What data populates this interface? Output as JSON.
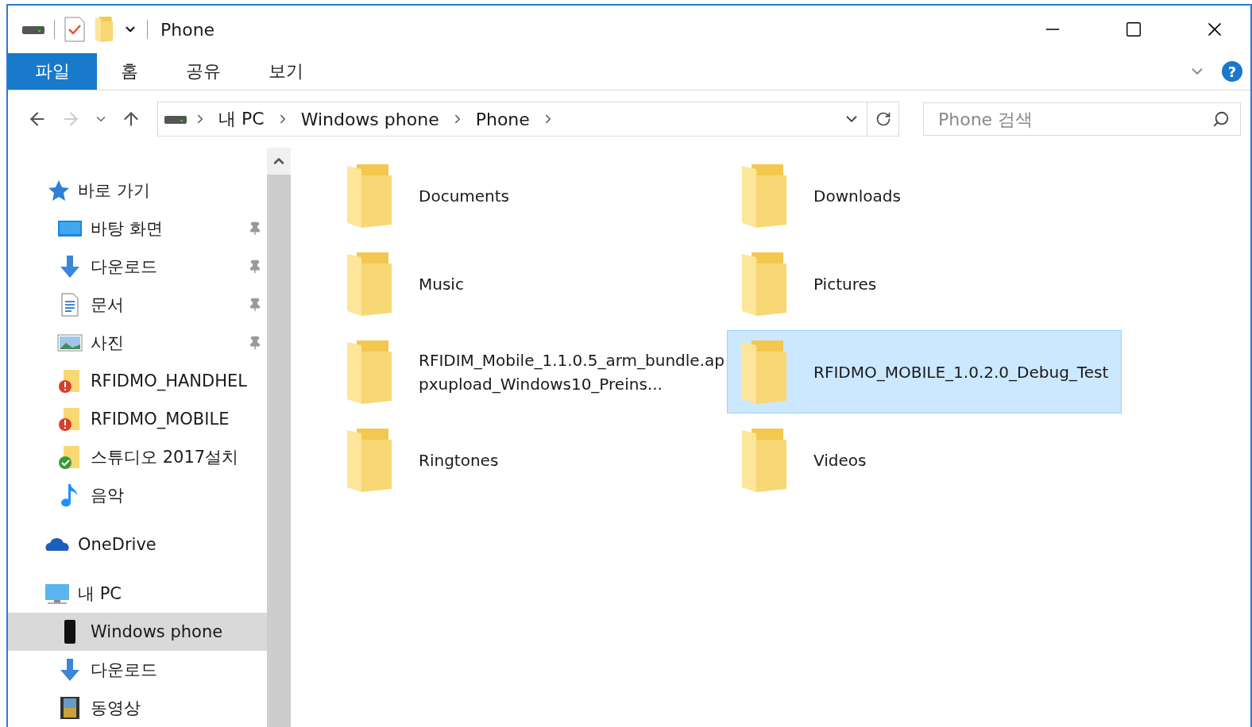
{
  "window": {
    "title": "Phone"
  },
  "ribbon": {
    "tabs": [
      {
        "label": "파일",
        "selected": true
      },
      {
        "label": "홈",
        "selected": false
      },
      {
        "label": "공유",
        "selected": false
      },
      {
        "label": "보기",
        "selected": false
      }
    ],
    "help": "?"
  },
  "navigation": {
    "back_disabled": false,
    "forward_disabled": true
  },
  "address": {
    "path": [
      "내 PC",
      "Windows phone",
      "Phone"
    ]
  },
  "search": {
    "placeholder": "Phone 검색"
  },
  "sidebar": {
    "items": [
      {
        "kind": "star",
        "label": "바로 가기",
        "selected": false,
        "children": [
          {
            "kind": "desktop",
            "label": "바탕 화면",
            "pinned": true,
            "selected": false
          },
          {
            "kind": "download",
            "label": "다운로드",
            "pinned": true,
            "selected": false
          },
          {
            "kind": "document",
            "label": "문서",
            "pinned": true,
            "selected": false
          },
          {
            "kind": "picture",
            "label": "사진",
            "pinned": true,
            "selected": false
          },
          {
            "kind": "folder-error",
            "label": "RFIDMO_HANDHEL",
            "pinned": false,
            "selected": false
          },
          {
            "kind": "folder-error",
            "label": "RFIDMO_MOBILE",
            "pinned": false,
            "selected": false
          },
          {
            "kind": "folder-ok",
            "label": "스튜디오 2017설치",
            "pinned": false,
            "selected": false
          },
          {
            "kind": "music",
            "label": "음악",
            "pinned": false,
            "selected": false
          }
        ]
      },
      {
        "kind": "cloud",
        "label": "OneDrive",
        "selected": false
      },
      {
        "kind": "pc",
        "label": "내 PC",
        "selected": false,
        "children": [
          {
            "kind": "phone",
            "label": "Windows phone",
            "pinned": false,
            "selected": true
          },
          {
            "kind": "download",
            "label": "다운로드",
            "pinned": false,
            "selected": false
          },
          {
            "kind": "video",
            "label": "동영상",
            "pinned": false,
            "selected": false
          }
        ]
      }
    ]
  },
  "files": [
    {
      "name": "Documents",
      "selected": false
    },
    {
      "name": "Downloads",
      "selected": false
    },
    {
      "name": "Music",
      "selected": false
    },
    {
      "name": "Pictures",
      "selected": false
    },
    {
      "name": "RFIDIM_Mobile_1.1.0.5_arm_bundle.appxupload_Windows10_Preins...",
      "selected": false
    },
    {
      "name": "RFIDMO_MOBILE_1.0.2.0_Debug_Test",
      "selected": true
    },
    {
      "name": "Ringtones",
      "selected": false
    },
    {
      "name": "Videos",
      "selected": false
    }
  ]
}
